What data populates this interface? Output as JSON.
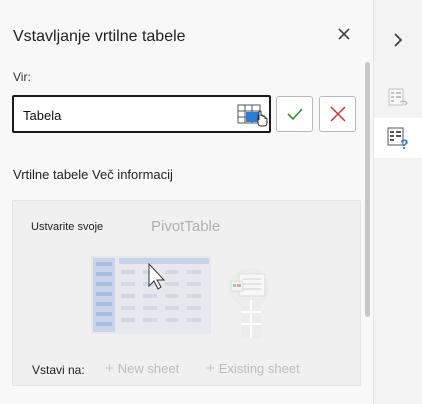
{
  "pane": {
    "title": "Vstavljanje vrtilne tabele",
    "source_label": "Vir:",
    "source_value": "Tabela",
    "section_title": "Vrtilne tabele Več informacij",
    "card": {
      "create_label": "Ustvarite svoje",
      "pivot_label": "PivotTable",
      "insert_label": "Vstavi na:",
      "new_sheet_label": "New sheet",
      "existing_sheet_label": "Existing sheet"
    }
  },
  "icons": {
    "close": "close-icon",
    "range": "select-range-icon",
    "confirm": "checkmark-icon",
    "cancel": "x-icon",
    "collapse": "chevron-right-icon",
    "recommended": "recommended-pivot-icon",
    "help": "pivot-help-icon"
  },
  "colors": {
    "accent_blue": "#2b7cd3",
    "confirm_green": "#3c8a3c",
    "cancel_red": "#d13438"
  }
}
